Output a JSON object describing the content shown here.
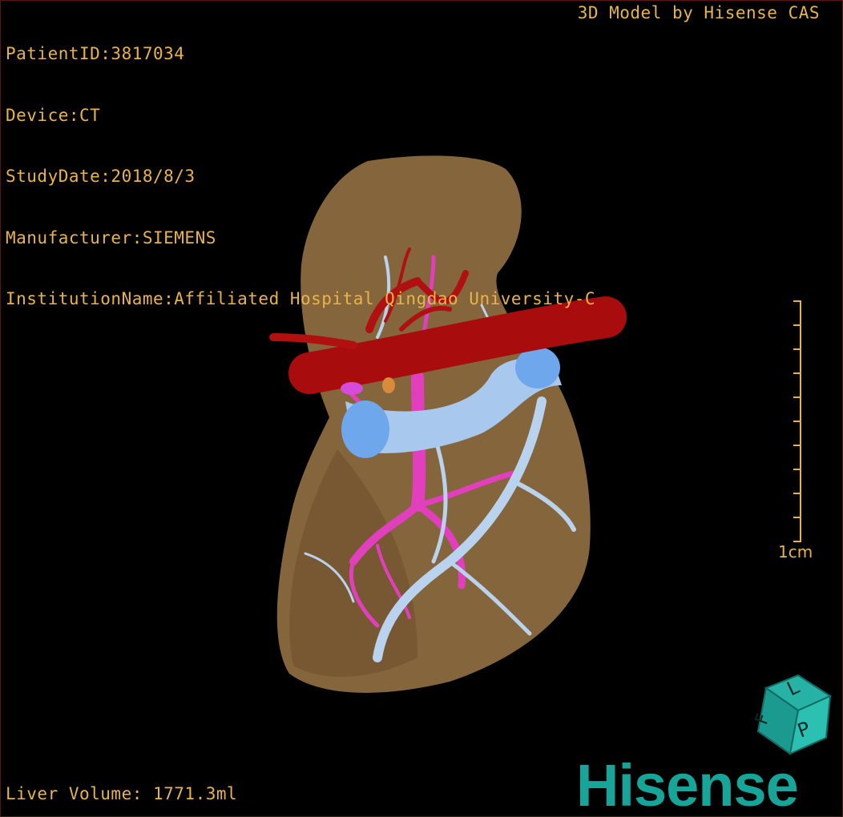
{
  "overlay": {
    "patient_id": "PatientID:3817034",
    "device": "Device:CT",
    "study_date": "StudyDate:2018/8/3",
    "manufacturer": "Manufacturer:SIEMENS",
    "institution": "InstitutionName:Affiliated Hospital Qingdao University-C",
    "credit": "3D Model by Hisense CAS",
    "liver_volume": "Liver Volume: 1771.3ml"
  },
  "scale_bar": {
    "label": "1cm"
  },
  "orientation_cube": {
    "face_letters": [
      "L",
      "P",
      "F"
    ]
  },
  "logo": {
    "text": "Hisense"
  },
  "colors": {
    "text": "#e8b44a",
    "liver": "#8c6a3e",
    "hepatic_artery": "#b01010",
    "portal_vein": "#e23fbf",
    "hepatic_vein": "#b9d3ef",
    "vena_cava": "#6fa7ec",
    "logo": "#17a59a"
  }
}
